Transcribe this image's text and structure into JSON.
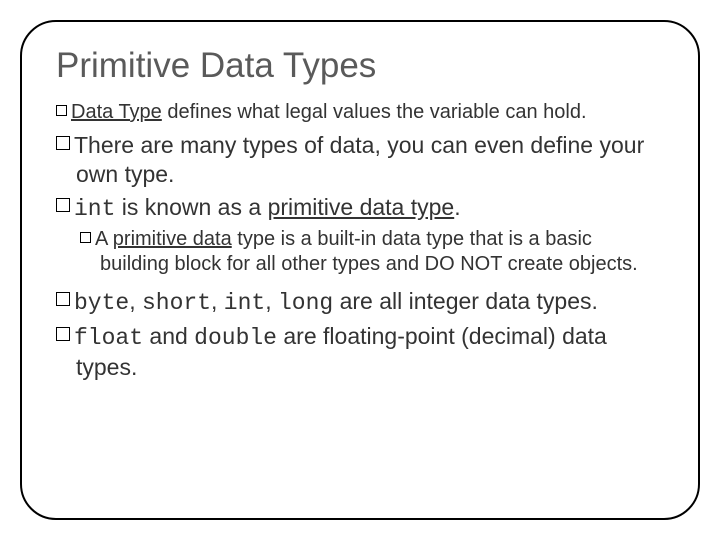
{
  "title": "Primitive Data Types",
  "items": {
    "b1": {
      "pre": "",
      "u": "Data Type",
      "post": " defines what legal values the variable can hold."
    },
    "b2": "There are many types of data, you can even define your own type.",
    "b3": {
      "code": "int",
      "mid": " is known as a ",
      "u": "primitive data type",
      "post": "."
    },
    "b4": {
      "pre": "A ",
      "u": "primitive data",
      "post": " type is a built-in data type that is a basic building block for all other types and DO NOT create objects."
    },
    "b5": {
      "c1": "byte",
      "s1": ", ",
      "c2": "short",
      "s2": ", ",
      "c3": "int",
      "s3": ", ",
      "c4": "long",
      "post": " are all integer data types."
    },
    "b6": {
      "c1": "float",
      "mid": " and ",
      "c2": "double",
      "post": " are floating-point (decimal) data types."
    }
  }
}
